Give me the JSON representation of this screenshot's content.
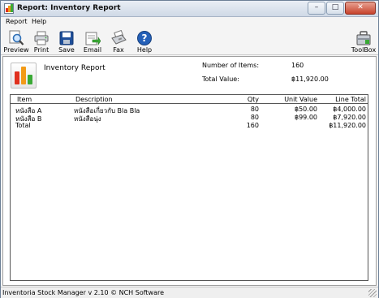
{
  "window": {
    "title": "Report: Inventory Report",
    "min_glyph": "–",
    "max_glyph": "□",
    "close_glyph": "✕"
  },
  "menu": [
    "Report",
    "Help"
  ],
  "toolbar": {
    "preview": "Preview",
    "print": "Print",
    "save": "Save",
    "email": "Email",
    "fax": "Fax",
    "help": "Help",
    "toolbox": "ToolBox"
  },
  "report": {
    "title": "Inventory Report",
    "items_label": "Number of Items:",
    "items_value": "160",
    "total_label": "Total Value:",
    "total_value": "฿11,920.00"
  },
  "table": {
    "headers": {
      "item": "Item",
      "description": "Description",
      "qty": "Qty",
      "unit_value": "Unit Value",
      "line_total": "Line Total"
    },
    "rows": [
      {
        "item": "หนังสือ A",
        "description": "หนังสือเกี่ยวกับ Bla Bla",
        "qty": "80",
        "unit_value": "฿50.00",
        "line_total": "฿4,000.00"
      },
      {
        "item": "หนังสือ B",
        "description": "หนังสือนุ่ง",
        "qty": "80",
        "unit_value": "฿99.00",
        "line_total": "฿7,920.00"
      },
      {
        "item": "Total",
        "description": "",
        "qty": "160",
        "unit_value": "",
        "line_total": "฿11,920.00"
      }
    ]
  },
  "status": "Inventoria Stock Manager v 2.10 © NCH Software",
  "colors": {
    "accent": "#2f6fb5",
    "logo_red": "#e0301e",
    "logo_orange": "#f29a17",
    "logo_green": "#3aa935"
  }
}
